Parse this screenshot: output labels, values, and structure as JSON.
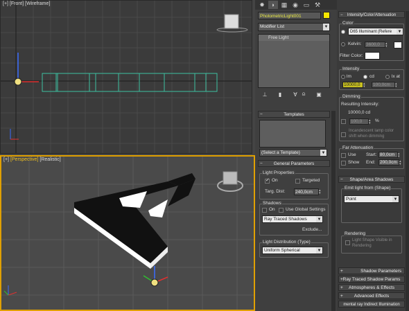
{
  "viewports": {
    "front": {
      "plus": "[+]",
      "view": "[Front]",
      "shading": "[Wireframe]"
    },
    "perspective": {
      "plus": "[+]",
      "view": "[Perspective]",
      "shading": "[Realistic]"
    }
  },
  "command_panel": {
    "tabs": [
      "create-icon",
      "modify-icon",
      "hierarchy-icon",
      "motion-icon",
      "display-icon",
      "utilities-icon"
    ],
    "object_name": "PhotometricLight001",
    "object_color": "#f5e600",
    "modifier_list": "Modifier List",
    "stack_items": [
      "Free Light"
    ],
    "templates": {
      "title": "Templates",
      "select": "(Select a Template)"
    },
    "general_parameters": {
      "title": "General Parameters",
      "light_properties": "Light Properties",
      "on_label": "On",
      "on_checked": true,
      "targeted_label": "Targeted",
      "targeted_checked": false,
      "targ_dist_label": "Targ. Dist:",
      "targ_dist_value": "240,0cm",
      "shadows_label": "Shadows",
      "shadows_on_label": "On",
      "use_global_label": "Use Global Settings",
      "shadow_type": "Ray Traced Shadows",
      "exclude_label": "Exclude...",
      "light_distribution_label": "Light Distribution (Type)",
      "distribution": "Uniform Spherical"
    }
  },
  "intensity_rollout": {
    "title": "Intensity/Color/Attenuation",
    "color_label": "Color",
    "color_preset": "D65 Illuminant (Refere",
    "kelvin_label": "Kelvin:",
    "kelvin_value": "3600,0",
    "filter_color_label": "Filter Color:",
    "intensity_label": "Intensity",
    "lm_label": "lm",
    "cd_label": "cd",
    "lx_label": "lx at",
    "intensity_value": "10000,0",
    "lx_distance": "100,0cm",
    "dimming_label": "Dimming",
    "resulting_label": "Resulting Intensity:",
    "resulting_value": "10000,0 cd",
    "dim_percent": "100,0",
    "percent_sign": "%",
    "incandescent_line1": "Incandescent lamp color",
    "incandescent_line2": "shift when dimming",
    "far_attenuation_label": "Far Attenuation",
    "use_label": "Use",
    "show_label": "Show",
    "start_label": "Start:",
    "start_value": "80,0cm",
    "end_label": "End:",
    "end_value": "200,0cm"
  },
  "shape_rollout": {
    "title": "Shape/Area Shadows",
    "emit_label": "Emit light from (Shape)",
    "shape": "Point",
    "rendering_label": "Rendering",
    "visible_line1": "Light Shape Visible in",
    "visible_line2": "Rendering"
  },
  "collapsed_rollouts": [
    "Shadow Parameters",
    "Ray Traced Shadow Params",
    "Atmospheres & Effects",
    "Advanced Effects",
    "mental ray Indirect Illumination"
  ]
}
